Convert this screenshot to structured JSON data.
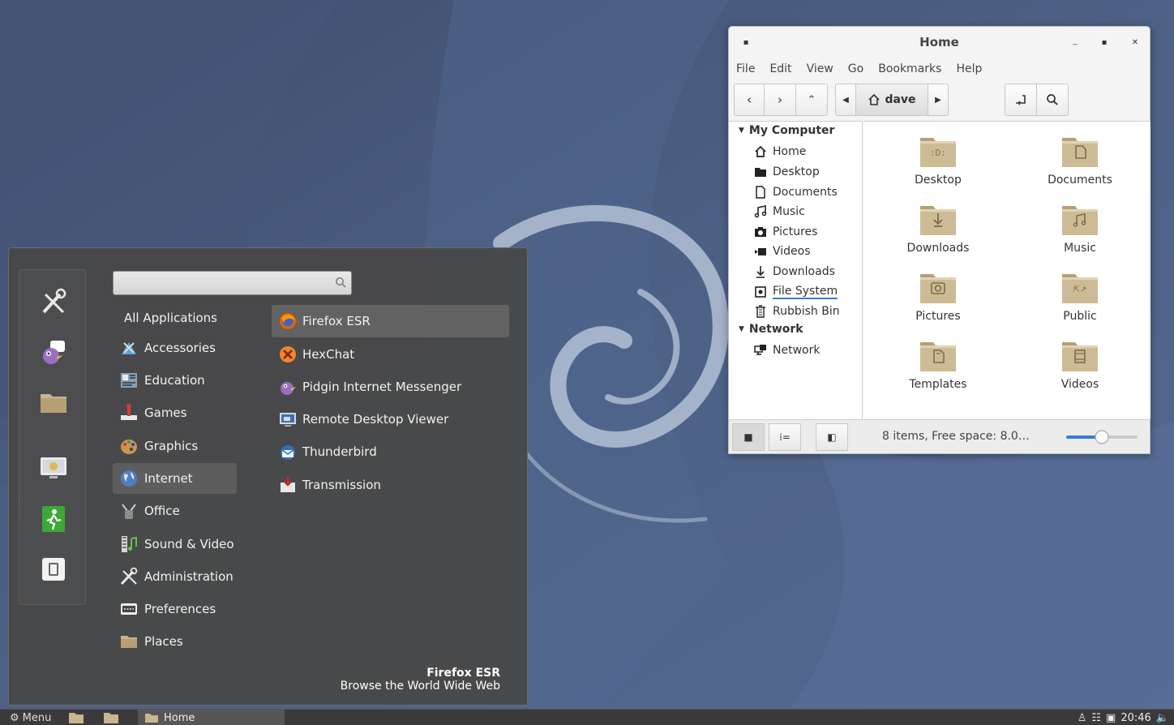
{
  "menu": {
    "search": {
      "value": "",
      "placeholder": ""
    },
    "favorites": [
      {
        "icon": "system-settings-icon"
      },
      {
        "icon": "pidgin-icon"
      },
      {
        "icon": "folder-icon"
      },
      {
        "icon": "screensaver-monitor-icon"
      },
      {
        "icon": "logout-icon"
      },
      {
        "icon": "shutdown-icon"
      }
    ],
    "categories": [
      {
        "label": "All Applications",
        "icon": ""
      },
      {
        "label": "Accessories",
        "icon": "accessories-icon"
      },
      {
        "label": "Education",
        "icon": "education-icon"
      },
      {
        "label": "Games",
        "icon": "games-icon"
      },
      {
        "label": "Graphics",
        "icon": "graphics-icon"
      },
      {
        "label": "Internet",
        "icon": "internet-globe-icon"
      },
      {
        "label": "Office",
        "icon": "office-icon"
      },
      {
        "label": "Sound & Video",
        "icon": "sound-video-icon"
      },
      {
        "label": "Administration",
        "icon": "administration-icon"
      },
      {
        "label": "Preferences",
        "icon": "preferences-icon"
      },
      {
        "label": "Places",
        "icon": "places-folder-icon"
      }
    ],
    "selected_category": "Internet",
    "apps": [
      {
        "label": "Firefox ESR",
        "icon": "firefox-icon"
      },
      {
        "label": "HexChat",
        "icon": "hexchat-icon"
      },
      {
        "label": "Pidgin Internet Messenger",
        "icon": "pidgin-icon"
      },
      {
        "label": "Remote Desktop Viewer",
        "icon": "remote-desktop-icon"
      },
      {
        "label": "Thunderbird",
        "icon": "thunderbird-icon"
      },
      {
        "label": "Transmission",
        "icon": "transmission-icon"
      }
    ],
    "selected_app": "Firefox ESR",
    "description": {
      "title": "Firefox ESR",
      "text": "Browse the World Wide Web"
    }
  },
  "file_manager": {
    "title": "Home",
    "menubar": [
      "File",
      "Edit",
      "View",
      "Go",
      "Bookmarks",
      "Help"
    ],
    "location": "dave",
    "sidebar": {
      "sections": [
        {
          "header": "My Computer",
          "items": [
            "Home",
            "Desktop",
            "Documents",
            "Music",
            "Pictures",
            "Videos",
            "Downloads",
            "File System",
            "Rubbish Bin"
          ]
        },
        {
          "header": "Network",
          "items": [
            "Network"
          ]
        }
      ]
    },
    "folders": [
      "Desktop",
      "Documents",
      "Downloads",
      "Music",
      "Pictures",
      "Public",
      "Templates",
      "Videos"
    ],
    "status": "8 items, Free space: 8.0…",
    "zoom_level": 0.5
  },
  "panel": {
    "menu_label": "Menu",
    "task_home": "Home",
    "clock": "20:46"
  },
  "colors": {
    "wallpaper": "#4a5d80",
    "debian_swirl": "#b4c1d6",
    "menu_bg": "#484848",
    "selection": "#5d5d5d",
    "folder": "#c9b58f",
    "zoom_accent": "#3a7bd5"
  }
}
